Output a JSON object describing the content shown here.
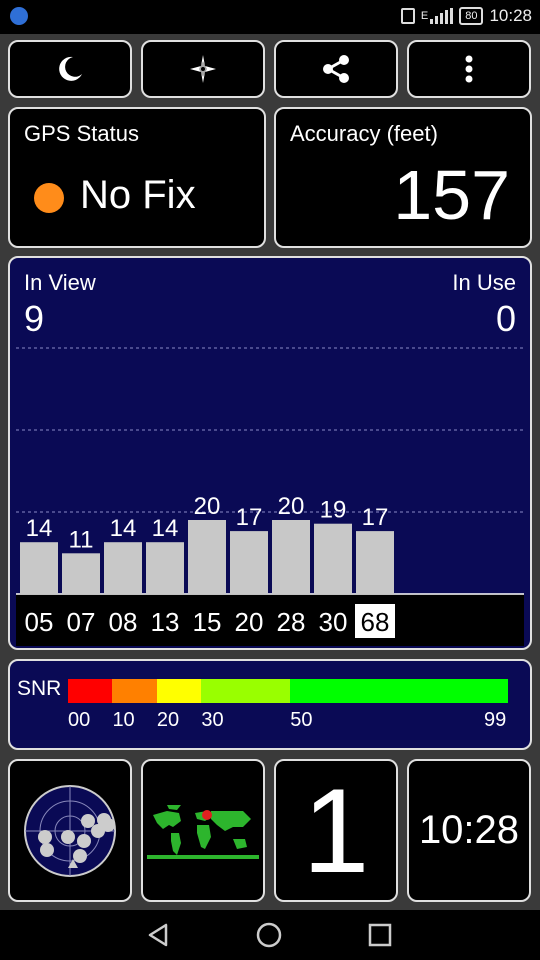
{
  "status_bar": {
    "time": "10:28",
    "battery": "80",
    "network": "E"
  },
  "toolbar": {
    "buttons": [
      {
        "icon": "moon-icon"
      },
      {
        "icon": "compass-star-icon"
      },
      {
        "icon": "share-icon"
      },
      {
        "icon": "more-vert-icon"
      }
    ]
  },
  "gps_status": {
    "label": "GPS Status",
    "value": "No Fix",
    "status_color": "#ff8c1a"
  },
  "accuracy": {
    "label": "Accuracy (feet)",
    "value": "157"
  },
  "satellites": {
    "in_view_label": "In View",
    "in_view": "9",
    "in_use_label": "In Use",
    "in_use": "0"
  },
  "chart_data": {
    "type": "bar",
    "categories": [
      "05",
      "07",
      "08",
      "13",
      "15",
      "20",
      "28",
      "30",
      "68"
    ],
    "values": [
      14,
      11,
      14,
      14,
      20,
      17,
      20,
      19,
      17
    ],
    "highlighted_category": "68",
    "ylim": [
      0,
      50
    ],
    "grid": true
  },
  "snr": {
    "label": "SNR",
    "segments": [
      {
        "from": 0,
        "to": 10,
        "color": "#ff0000"
      },
      {
        "from": 10,
        "to": 20,
        "color": "#ff8000"
      },
      {
        "from": 20,
        "to": 30,
        "color": "#ffff00"
      },
      {
        "from": 30,
        "to": 50,
        "color": "#99ff00"
      },
      {
        "from": 50,
        "to": 99,
        "color": "#00ff00"
      }
    ],
    "ticks": [
      "00",
      "10",
      "20",
      "30",
      "50",
      "99"
    ]
  },
  "bottom": {
    "radar_icon": "satellite-radar-icon",
    "map_icon": "world-map-icon",
    "counter": "1",
    "clock": "10:28"
  },
  "nav": {
    "back": "back-icon",
    "home": "home-icon",
    "recents": "recents-icon"
  }
}
